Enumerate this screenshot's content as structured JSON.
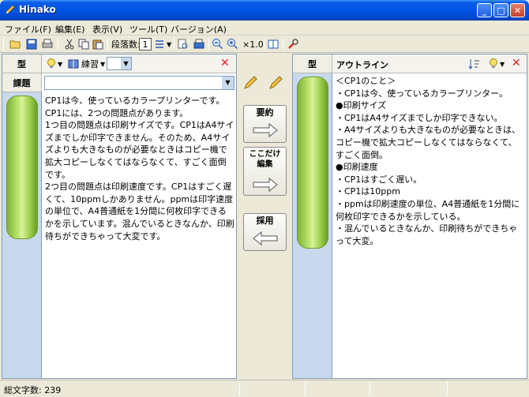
{
  "window": {
    "title": "Hinako",
    "min_label": "_",
    "max_label": "□",
    "close_label": "✕"
  },
  "menu": [
    "ファイル(F)",
    "編集(E)",
    "表示(V)",
    "ツール(T)",
    "バージョン(A)"
  ],
  "toolbar": {
    "paragraph_label": "段落数:",
    "paragraph_value": "1",
    "zoom_label": "×1.0"
  },
  "left_panel": {
    "type_label": "型",
    "exercise_label": "練習",
    "task_label": "課題",
    "text": "CP1は今、使っているカラープリンターです。CP1には、2つの問題点があります。\n1つ目の問題点は印刷サイズです。CP1はA4サイズまでしか印字できません。そのため、A4サイズよりも大きなものが必要なときはコピー機で拡大コピーしなくてはならなくて、すごく面倒です。\n2つ目の問題点は印刷速度です。CP1はすごく遅くて、10ppmしかありません。ppmは印字速度の単位で、A4普通紙を1分間に何枚印字できるかを示しています。混んでいるときなんか、印刷待ちができちゃって大変です。"
  },
  "middle": {
    "summarize_label": "要約",
    "koko_label_1": "ここだけ",
    "koko_label_2": "編集",
    "adopt_label": "採用"
  },
  "right_panel": {
    "type_label": "型",
    "outline_label": "アウトライン",
    "lines": [
      "＜CP1のこと＞",
      "・CP1は今、使っているカラープリンター。",
      "●印刷サイズ",
      "・CP1はA4サイズまでしか印字できない。",
      "・A4サイズよりも大きなものが必要なときは、コピー機で拡大コピーしなくてはならなくて、すごく面倒。",
      "●印刷速度",
      "・CP1はすごく遅い。",
      "・CP1は10ppm",
      "・ppmは印刷速度の単位、A4普通紙を1分間に何枚印字できるかを示している。",
      "・混んでいるときなんか、印刷待ちができちゃって大変。"
    ]
  },
  "status": {
    "char_count": "総文字数: 239"
  }
}
